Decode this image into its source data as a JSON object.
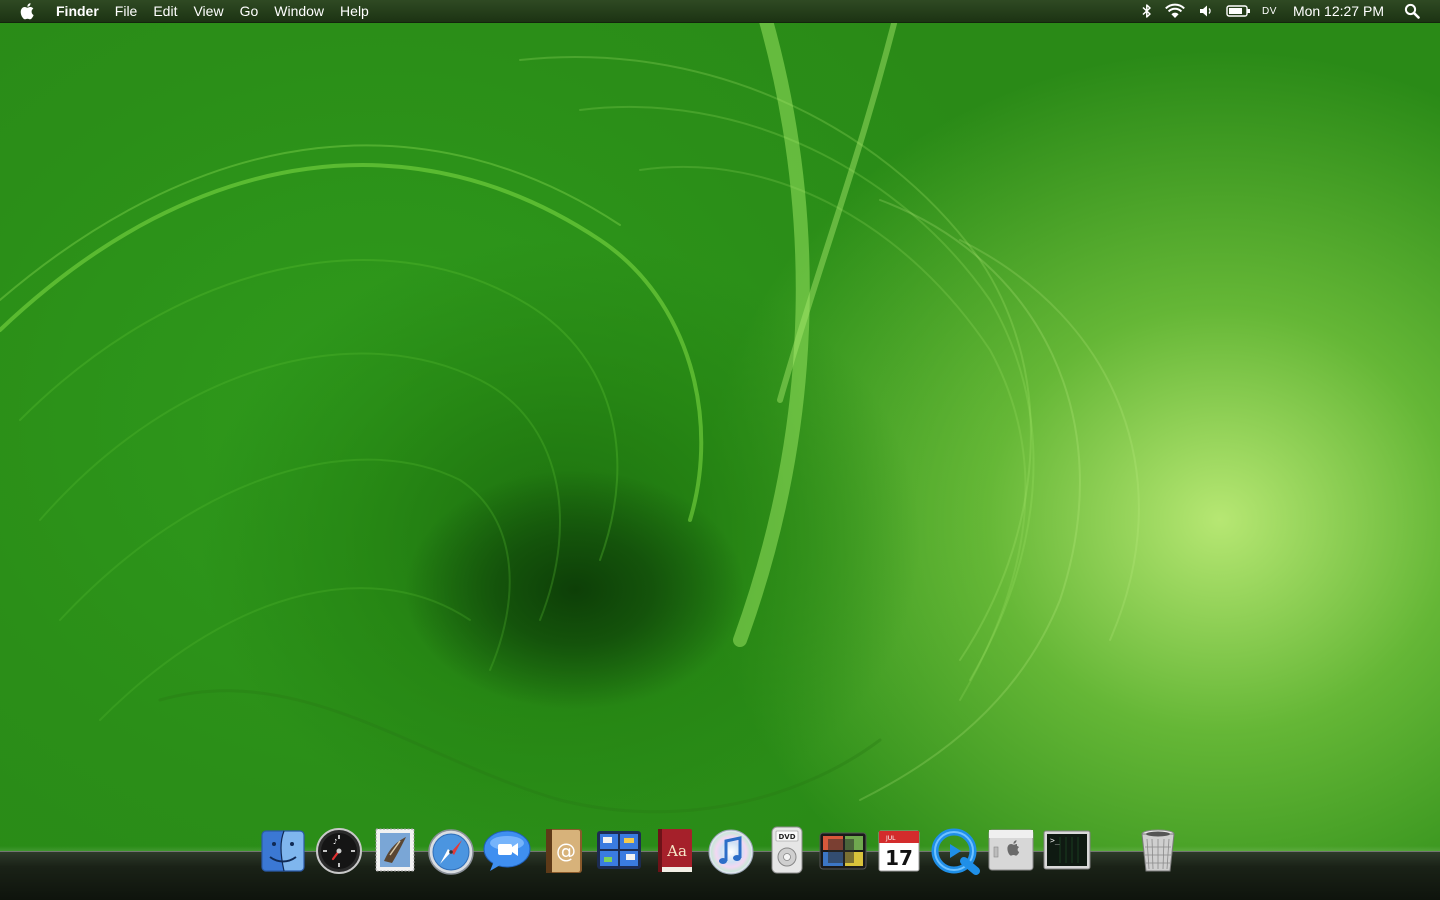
{
  "menubar": {
    "apple_icon": "apple-icon",
    "app_name": "Finder",
    "menus": [
      {
        "label": "File"
      },
      {
        "label": "Edit"
      },
      {
        "label": "View"
      },
      {
        "label": "Go"
      },
      {
        "label": "Window"
      },
      {
        "label": "Help"
      }
    ],
    "status": {
      "bluetooth_icon": "bluetooth-icon",
      "wifi_icon": "wifi-icon",
      "volume_icon": "volume-icon",
      "battery_icon": "battery-icon",
      "input_source": "DV",
      "clock": "Mon 12:27 PM",
      "spotlight_icon": "spotlight-search-icon"
    }
  },
  "desktop": {
    "wallpaper": "green leaf",
    "colors": {
      "dark_green": "#14530b",
      "mid_green": "#2f9b1e",
      "light_green": "#b6e68a"
    }
  },
  "dock": {
    "apps": [
      {
        "name": "finder-icon"
      },
      {
        "name": "dashboard-icon"
      },
      {
        "name": "mail-icon"
      },
      {
        "name": "safari-icon"
      },
      {
        "name": "ichat-icon"
      },
      {
        "name": "address-book-icon"
      },
      {
        "name": "spaces-icon"
      },
      {
        "name": "dictionary-icon",
        "text": "Aa"
      },
      {
        "name": "itunes-icon"
      },
      {
        "name": "dvd-player-icon",
        "text": "DVD"
      },
      {
        "name": "photo-booth-icon"
      },
      {
        "name": "ical-icon",
        "text": "17",
        "month": "JUL"
      },
      {
        "name": "quicktime-icon"
      },
      {
        "name": "system-preferences-icon"
      },
      {
        "name": "terminal-icon",
        "text": ">_"
      }
    ],
    "trash": {
      "name": "trash-icon"
    }
  }
}
